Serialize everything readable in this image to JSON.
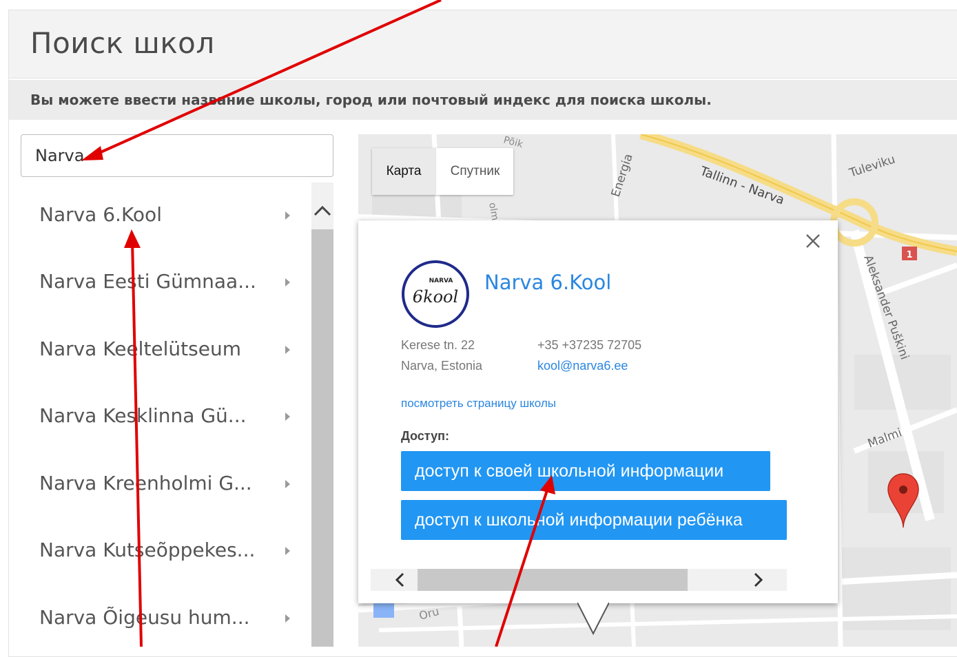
{
  "page": {
    "title": "Поиск школ",
    "subtitle": "Вы можете ввести название школы, город или почтовый индекс для поиска школы."
  },
  "search": {
    "value": "Narva"
  },
  "results": [
    {
      "label": "Narva 6.Kool"
    },
    {
      "label": "Narva Eesti Gümnaa..."
    },
    {
      "label": "Narva Keeltelütseum"
    },
    {
      "label": "Narva Kesklinna Gü..."
    },
    {
      "label": "Narva Kreenholmi G..."
    },
    {
      "label": "Narva Kutseõppekes..."
    },
    {
      "label": "Narva Õigeusu hum..."
    }
  ],
  "map": {
    "type_map": "Карта",
    "type_satellite": "Спутник",
    "streets": {
      "tallinn_narva": "Tallinn - Narva",
      "tuleviku": "Tuleviku",
      "energia": "Energia",
      "aleksander": "Aleksander Puškini",
      "malmi": "Malmi",
      "oru": "Oru",
      "olm": "olm",
      "poik": "Põik"
    },
    "route_badge": "1"
  },
  "info": {
    "school_name": "Narva 6.Kool",
    "address_line1": "Kerese tn. 22",
    "address_line2": "Narva, Estonia",
    "phone": "+35 +37235 72705",
    "email": "kool@narva6.ee",
    "view_link": "посмотреть страницу школы",
    "access_label": "Доступ:",
    "btn_own": "доступ к своей школьной информации",
    "btn_child": "доступ к школьной информации ребёнка",
    "logo_text_top": "NARVA",
    "logo_text": "6kool"
  },
  "colors": {
    "accent": "#2196f3",
    "link": "#2a86e0",
    "annotation": "#e00000"
  }
}
